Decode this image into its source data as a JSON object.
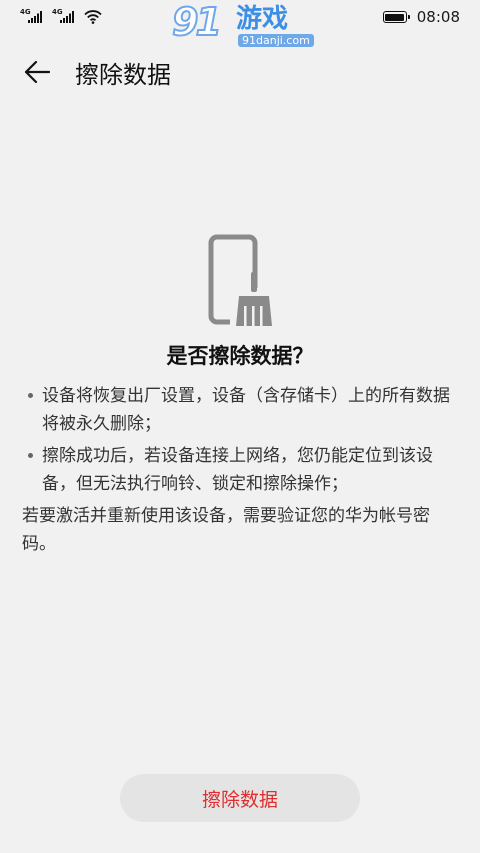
{
  "status_bar": {
    "sim1_tag": "4G",
    "sim2_tag": "4G",
    "time": "08:08"
  },
  "watermark": {
    "logo": "91",
    "name": "游戏",
    "url": "91danji.com"
  },
  "header": {
    "title": "擦除数据"
  },
  "main": {
    "question": "是否擦除数据？",
    "bullets": [
      "设备将恢复出厂设置，设备（含存储卡）上的所有数据将被永久删除；",
      "擦除成功后，若设备连接上网络，您仍能定位到该设备，但无法执行响铃、锁定和擦除操作；"
    ],
    "note": "若要激活并重新使用该设备，需要验证您的华为帐号密码。"
  },
  "footer": {
    "erase_label": "擦除数据"
  },
  "colors": {
    "background": "#f1f1f1",
    "button_bg": "#e4e4e4",
    "danger_text": "#e02d2d",
    "illustration": "#8a8a8a"
  }
}
